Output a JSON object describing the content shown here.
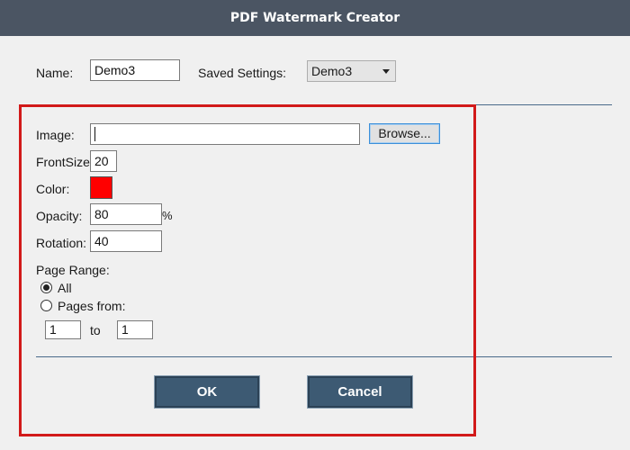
{
  "window": {
    "title": "PDF Watermark Creator"
  },
  "header": {
    "name_label": "Name:",
    "name_value": "Demo3",
    "saved_settings_label": "Saved Settings:",
    "saved_settings_value": "Demo3"
  },
  "form": {
    "image_label": "Image:",
    "image_value": "",
    "browse_label": "Browse...",
    "fontsize_label": "FrontSize",
    "fontsize_value": "20",
    "color_label": "Color:",
    "color_value": "#ff0000",
    "opacity_label": "Opacity:",
    "opacity_value": "80",
    "opacity_unit": "%",
    "rotation_label": "Rotation:",
    "rotation_value": "40",
    "page_range_label": "Page Range:",
    "all_label": "All",
    "pages_from_label": "Pages from:",
    "from_value": "1",
    "to_label": "to",
    "to_value": "1"
  },
  "buttons": {
    "ok_label": "OK",
    "cancel_label": "Cancel"
  },
  "colors": {
    "titlebar": "#4b5563",
    "button": "#3d5a73",
    "highlight": "#d21a1a"
  }
}
